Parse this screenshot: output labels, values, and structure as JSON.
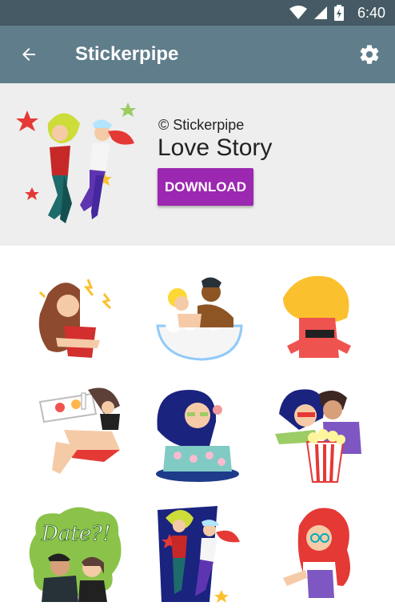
{
  "status_bar": {
    "time": "6:40",
    "icons": [
      "wifi-icon",
      "signal-icon",
      "battery-icon"
    ]
  },
  "app_bar": {
    "title": "Stickerpipe",
    "back_icon": "arrow-back-icon",
    "settings_icon": "gear-icon"
  },
  "pack": {
    "copyright": "© Stickerpipe",
    "name": "Love Story",
    "download_label": "DOWNLOAD"
  },
  "colors": {
    "status_bar": "#455a64",
    "app_bar": "#607d8b",
    "header_bg": "#eeeeee",
    "download": "#9c27b0"
  },
  "stickers": [
    "angry-woman-sticker",
    "bathtub-couple-sticker",
    "blonde-back-sticker",
    "breakfast-tray-sticker",
    "cake-woman-sticker",
    "popcorn-couple-sticker",
    "date-sticker",
    "dancing-couple-sticker",
    "redhead-woman-sticker"
  ],
  "sticker_texts": {
    "date": "Date?!"
  }
}
